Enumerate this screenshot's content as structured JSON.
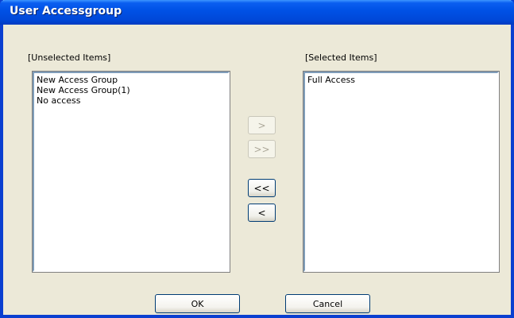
{
  "window": {
    "title": "User Accessgroup"
  },
  "unselected": {
    "label": "[Unselected Items]",
    "items": [
      "New Access Group",
      "New Access Group(1)",
      "No access"
    ]
  },
  "selected": {
    "label": "[Selected Items]",
    "items": [
      "Full Access"
    ]
  },
  "transfer_buttons": {
    "move_right": {
      "label": ">",
      "enabled": false
    },
    "move_all_right": {
      "label": ">>",
      "enabled": false
    },
    "move_all_left": {
      "label": "<<",
      "enabled": true
    },
    "move_left": {
      "label": "<",
      "enabled": true
    }
  },
  "footer": {
    "ok_label": "OK",
    "cancel_label": "Cancel"
  },
  "colors": {
    "titlebar": "#0054e3",
    "dialog_background": "#ece9d8",
    "button_border": "#003c74",
    "disabled_text": "#aca899"
  }
}
